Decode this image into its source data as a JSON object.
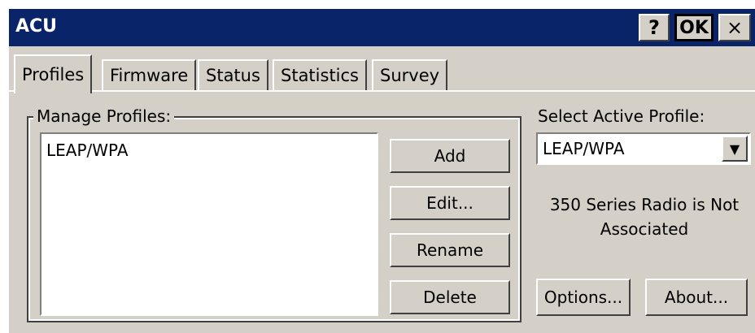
{
  "window": {
    "title": "ACU",
    "help_label": "?",
    "ok_label": "OK",
    "close_label": "×"
  },
  "tabs": [
    {
      "label": "Profiles",
      "active": true
    },
    {
      "label": "Firmware"
    },
    {
      "label": "Status"
    },
    {
      "label": "Statistics"
    },
    {
      "label": "Survey"
    }
  ],
  "manage": {
    "label": "Manage Profiles:",
    "profiles": [
      "LEAP/WPA"
    ],
    "add_label": "Add",
    "edit_label": "Edit...",
    "rename_label": "Rename",
    "delete_label": "Delete"
  },
  "active_profile": {
    "label": "Select Active Profile:",
    "selected": "LEAP/WPA",
    "dropdown_arrow": "▼"
  },
  "status_text": "350 Series Radio is Not Associated",
  "footer": {
    "options_label": "Options...",
    "about_label": "About..."
  },
  "colors": {
    "titlebar": "#0a246a",
    "face": "#d4d0c8"
  }
}
